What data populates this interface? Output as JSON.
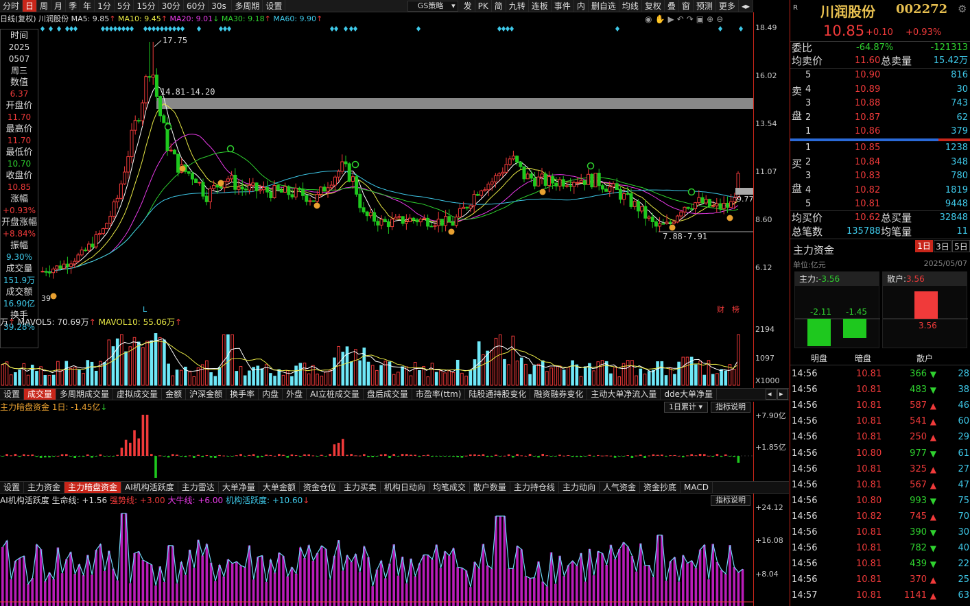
{
  "toolbar": {
    "items": [
      "分时",
      "日",
      "周",
      "月",
      "季",
      "年",
      "1分",
      "5分",
      "15分",
      "30分",
      "60分",
      "30s",
      "多周期",
      "设置"
    ],
    "active": "日",
    "strategy": "GS策略",
    "right_items": [
      "发",
      "PK",
      "简",
      "九转",
      "连板",
      "事件",
      "内",
      "删自选",
      "均线",
      "复权",
      "叠",
      "窗",
      "预测",
      "更多"
    ]
  },
  "legend": {
    "prefix": "日线(复权) 川润股份",
    "ma5": "MA5: 9.85",
    "ma10": "MA10: 9.45",
    "ma20": "MA20: 9.01",
    "ma30": "MA30: 9.18",
    "ma60": "MA60: 9.90"
  },
  "info": [
    {
      "label": "时间",
      "values": [
        "2025",
        "0507",
        "周三"
      ],
      "cls": "white"
    },
    {
      "label": "数值",
      "values": [
        "6.37"
      ],
      "cls": "red"
    },
    {
      "label": "开盘价",
      "values": [
        "11.70"
      ],
      "cls": "red"
    },
    {
      "label": "最高价",
      "values": [
        "11.70"
      ],
      "cls": "red"
    },
    {
      "label": "最低价",
      "values": [
        "10.70"
      ],
      "cls": "green"
    },
    {
      "label": "收盘价",
      "values": [
        "10.85"
      ],
      "cls": "red"
    },
    {
      "label": "涨幅",
      "values": [
        "+0.93%"
      ],
      "cls": "red"
    },
    {
      "label": "开盘涨幅",
      "values": [
        "+8.84%"
      ],
      "cls": "red"
    },
    {
      "label": "振幅",
      "values": [
        "9.30%"
      ],
      "cls": "cyan"
    },
    {
      "label": "成交量",
      "values": [
        "151.9万"
      ],
      "cls": "cyan"
    },
    {
      "label": "成交额",
      "values": [
        "16.90亿"
      ],
      "cls": "cyan"
    },
    {
      "label": "换手",
      "values": [
        "39.28%"
      ],
      "cls": "cyan"
    }
  ],
  "price_axis": [
    "18.49",
    "16.02",
    "13.54",
    "11.07",
    "8.60",
    "6.12"
  ],
  "annotations": {
    "high": "17.75",
    "band": "14.81-14.20",
    "low": "7.88-7.91",
    "right_val": "9.77",
    "start_val": "39",
    "L": "L",
    "cai": "财",
    "bang": "榜"
  },
  "vol_legend": {
    "prefix": "万",
    "mavol5": "MAVOL5: 70.69万",
    "mavol10": "MAVOL10: 55.06万"
  },
  "vol_axis": [
    "2194",
    "1097",
    "X1000"
  ],
  "tabs1": [
    "设置",
    "成交量",
    "多周期成交量",
    "虚拟成交量",
    "金额",
    "沪深金额",
    "换手率",
    "内盘",
    "外盘",
    "AI立桩成交量",
    "盘后成交量",
    "市盈率(ttm)",
    "陆股通持股变化",
    "融资融券变化",
    "主动大单净流入量",
    "dde大单净量"
  ],
  "tabs1_active": "成交量",
  "dark_legend": "主力暗盘资金 1日: -1.45亿",
  "dark_btn": "1日累计",
  "explain": "指标说明",
  "dark_axis": [
    "+7.90亿",
    "+1.85亿"
  ],
  "tabs2": [
    "设置",
    "主力资金",
    "主力暗盘资金",
    "AI机构活跃度",
    "主力雷达",
    "大单净量",
    "大单金额",
    "资金仓位",
    "主力买卖",
    "机构日动向",
    "均笔成交",
    "散户数量",
    "主力持仓线",
    "主力动向",
    "人气资金",
    "资金抄底",
    "MACD"
  ],
  "tabs2_active": "主力暗盘资金",
  "ai_legend": {
    "prefix": "AI机构活跃度 生命线: +1.56",
    "strong": "强势线: +3.00",
    "bull": "大牛线: +6.00",
    "active": "机构活跃度: +10.60"
  },
  "ai_axis": [
    "+24.12",
    "+16.08",
    "+8.04"
  ],
  "stock": {
    "name": "川润股份",
    "code": "002272",
    "price": "10.85",
    "change": "+0.10",
    "pct": "+0.93%"
  },
  "weibi": {
    "label": "委比",
    "pct": "-64.87%",
    "val": "-121313"
  },
  "avg_sell": {
    "label": "均卖价",
    "val": "11.60",
    "vol_label": "总卖量",
    "vol": "15.42万"
  },
  "sell": [
    {
      "n": "5",
      "p": "10.90",
      "v": "816"
    },
    {
      "n": "4",
      "p": "10.89",
      "v": "30"
    },
    {
      "n": "3",
      "p": "10.88",
      "v": "743"
    },
    {
      "n": "2",
      "p": "10.87",
      "v": "62"
    },
    {
      "n": "1",
      "p": "10.86",
      "v": "379"
    }
  ],
  "buy": [
    {
      "n": "1",
      "p": "10.85",
      "v": "1238"
    },
    {
      "n": "2",
      "p": "10.84",
      "v": "348"
    },
    {
      "n": "3",
      "p": "10.83",
      "v": "780"
    },
    {
      "n": "4",
      "p": "10.82",
      "v": "1819"
    },
    {
      "n": "5",
      "p": "10.81",
      "v": "9448"
    }
  ],
  "sell_label": [
    "卖",
    "盘"
  ],
  "buy_label": [
    "买",
    "盘"
  ],
  "avg_buy": {
    "label": "均买价",
    "val": "10.62",
    "vol_label": "总买量",
    "vol": "32848"
  },
  "total": {
    "label": "总笔数",
    "val": "135788",
    "avg_label": "均笔量",
    "avg": "11"
  },
  "flow": {
    "title": "主力资金",
    "tabs": [
      "1日",
      "3日",
      "5日"
    ],
    "unit": "单位:亿元",
    "date": "2025/05/07",
    "main_label": "主力:",
    "main_val": "-3.56",
    "retail_label": "散户:",
    "retail_val": "3.56",
    "ming": "-2.11",
    "an": "-1.45",
    "retail_bar": "3.56",
    "cols": [
      "明盘",
      "暗盘",
      "散户"
    ]
  },
  "ticks": [
    {
      "t": "14:56",
      "p": "10.81",
      "v": "366",
      "d": "down",
      "n": "28"
    },
    {
      "t": "14:56",
      "p": "10.81",
      "v": "483",
      "d": "down",
      "n": "38"
    },
    {
      "t": "14:56",
      "p": "10.81",
      "v": "587",
      "d": "up",
      "n": "46"
    },
    {
      "t": "14:56",
      "p": "10.81",
      "v": "541",
      "d": "up",
      "n": "60"
    },
    {
      "t": "14:56",
      "p": "10.81",
      "v": "250",
      "d": "up",
      "n": "29"
    },
    {
      "t": "14:56",
      "p": "10.80",
      "v": "977",
      "d": "down",
      "n": "61"
    },
    {
      "t": "14:56",
      "p": "10.81",
      "v": "325",
      "d": "up",
      "n": "27"
    },
    {
      "t": "14:56",
      "p": "10.81",
      "v": "567",
      "d": "up",
      "n": "47"
    },
    {
      "t": "14:56",
      "p": "10.80",
      "v": "993",
      "d": "down",
      "n": "75"
    },
    {
      "t": "14:56",
      "p": "10.82",
      "v": "745",
      "d": "up",
      "n": "70"
    },
    {
      "t": "14:56",
      "p": "10.81",
      "v": "390",
      "d": "down",
      "n": "30"
    },
    {
      "t": "14:56",
      "p": "10.81",
      "v": "782",
      "d": "down",
      "n": "40"
    },
    {
      "t": "14:56",
      "p": "10.81",
      "v": "439",
      "d": "down",
      "n": "22"
    },
    {
      "t": "14:56",
      "p": "10.81",
      "v": "370",
      "d": "up",
      "n": "25"
    },
    {
      "t": "14:57",
      "p": "10.81",
      "v": "1141",
      "d": "up",
      "n": "63"
    }
  ]
}
